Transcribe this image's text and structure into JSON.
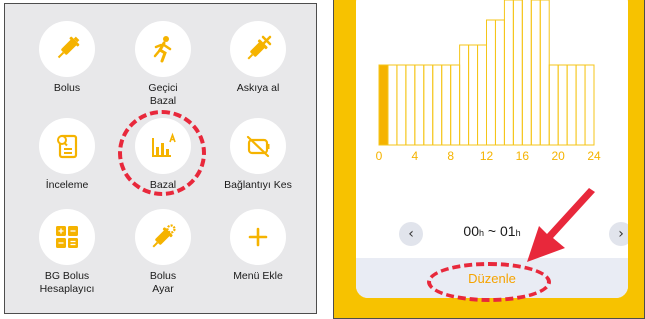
{
  "menu": {
    "items": [
      {
        "label": "Bolus",
        "icon": "syringe-icon"
      },
      {
        "label": "Geçici\nBazal",
        "icon": "running-person-icon"
      },
      {
        "label": "Askıya al",
        "icon": "syringe-cancel-icon"
      },
      {
        "label": "İnceleme",
        "icon": "report-review-icon"
      },
      {
        "label": "Bazal",
        "icon": "bar-chart-a-icon"
      },
      {
        "label": "Bağlantıyı Kes",
        "icon": "disconnect-icon"
      },
      {
        "label": "BG Bolus\nHesaplayıcı",
        "icon": "calculator-icon"
      },
      {
        "label": "Bolus\nAyar",
        "icon": "syringe-gear-icon"
      },
      {
        "label": "Menü Ekle",
        "icon": "plus-icon"
      }
    ]
  },
  "basal": {
    "x_ticks": [
      "0",
      "4",
      "8",
      "12",
      "16",
      "20",
      "24"
    ],
    "time_start": "00",
    "time_end": "01",
    "hour_unit": "h",
    "separator": "~",
    "prev_icon": "chevron-left-icon",
    "next_icon": "chevron-right-icon",
    "edit_label": "Düzenle"
  },
  "chart_data": {
    "type": "bar",
    "x": [
      0,
      1,
      2,
      3,
      4,
      5,
      6,
      7,
      8,
      9,
      10,
      11,
      12,
      13,
      14,
      15,
      16,
      17,
      18,
      19,
      20,
      21,
      22,
      23
    ],
    "values": [
      0.8,
      0.8,
      0.8,
      0.8,
      0.8,
      0.8,
      0.8,
      0.8,
      0.8,
      1.0,
      1.0,
      1.0,
      1.25,
      1.25,
      1.45,
      1.45,
      1.75,
      1.45,
      1.45,
      0.8,
      0.8,
      0.8,
      0.8,
      0.8
    ],
    "highlighted_hour": 0,
    "x_tick_labels": [
      "0",
      "4",
      "8",
      "12",
      "16",
      "20",
      "24"
    ],
    "colors": {
      "bar_outline": "#f5c518",
      "highlight_fill": "#f5b300"
    }
  },
  "colors": {
    "accent": "#f7c200",
    "annotation": "#e8283b"
  }
}
